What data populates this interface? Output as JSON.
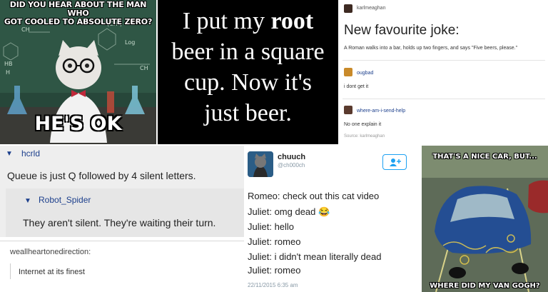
{
  "cat_meme": {
    "top_line1": "DID YOU HEAR ABOUT THE MAN WHO",
    "top_line2": "GOT COOLED TO ABSOLUTE ZERO?",
    "bottom": "HE'S OK",
    "board_text": [
      "CH",
      "(CH³)",
      "Log",
      "HB",
      "H",
      "CH"
    ]
  },
  "root_beer": {
    "line1_pre": "I put my ",
    "line1_bold": "root",
    "line2": "beer in a square",
    "line3": "cup. Now it's",
    "line4": "just beer."
  },
  "joke_post": {
    "author": "karlmeaghan",
    "title": "New favourite joke:",
    "body": "A Roman walks into a bar, holds up two fingers, and says \"Five beers, please.\"",
    "reply1_user": "ougbad",
    "reply1_text": "i dont get it",
    "reply2_user": "where-am-i-send-help",
    "reply2_text": "No one explain it",
    "source": "Source: karlmeaghan"
  },
  "queue_post": {
    "user1": "hcrld",
    "text1": "Queue is just Q followed by 4 silent letters.",
    "user2": "Robot_Spider",
    "text2": "They aren't silent. They're waiting their turn.",
    "user3": "weallheartonedirection:",
    "text3": "Internet at its finest"
  },
  "tweet": {
    "name": "chuuch",
    "handle": "@ch000ch",
    "lines": [
      "Romeo: check out this cat video",
      "Juliet: omg dead 😂",
      "Juliet: hello",
      "Juliet: romeo",
      "Juliet: i didn't mean literally dead",
      "Juliet: romeo"
    ],
    "date": "22/11/2015 6:35 am",
    "follow_icon": "add-user-icon"
  },
  "car_meme": {
    "top": "THAT'S A NICE CAR, BUT...",
    "bottom": "WHERE DID MY VAN GOGH?"
  },
  "colors": {
    "link_blue": "#1c3f8c",
    "twitter_blue": "#1da1f2"
  }
}
